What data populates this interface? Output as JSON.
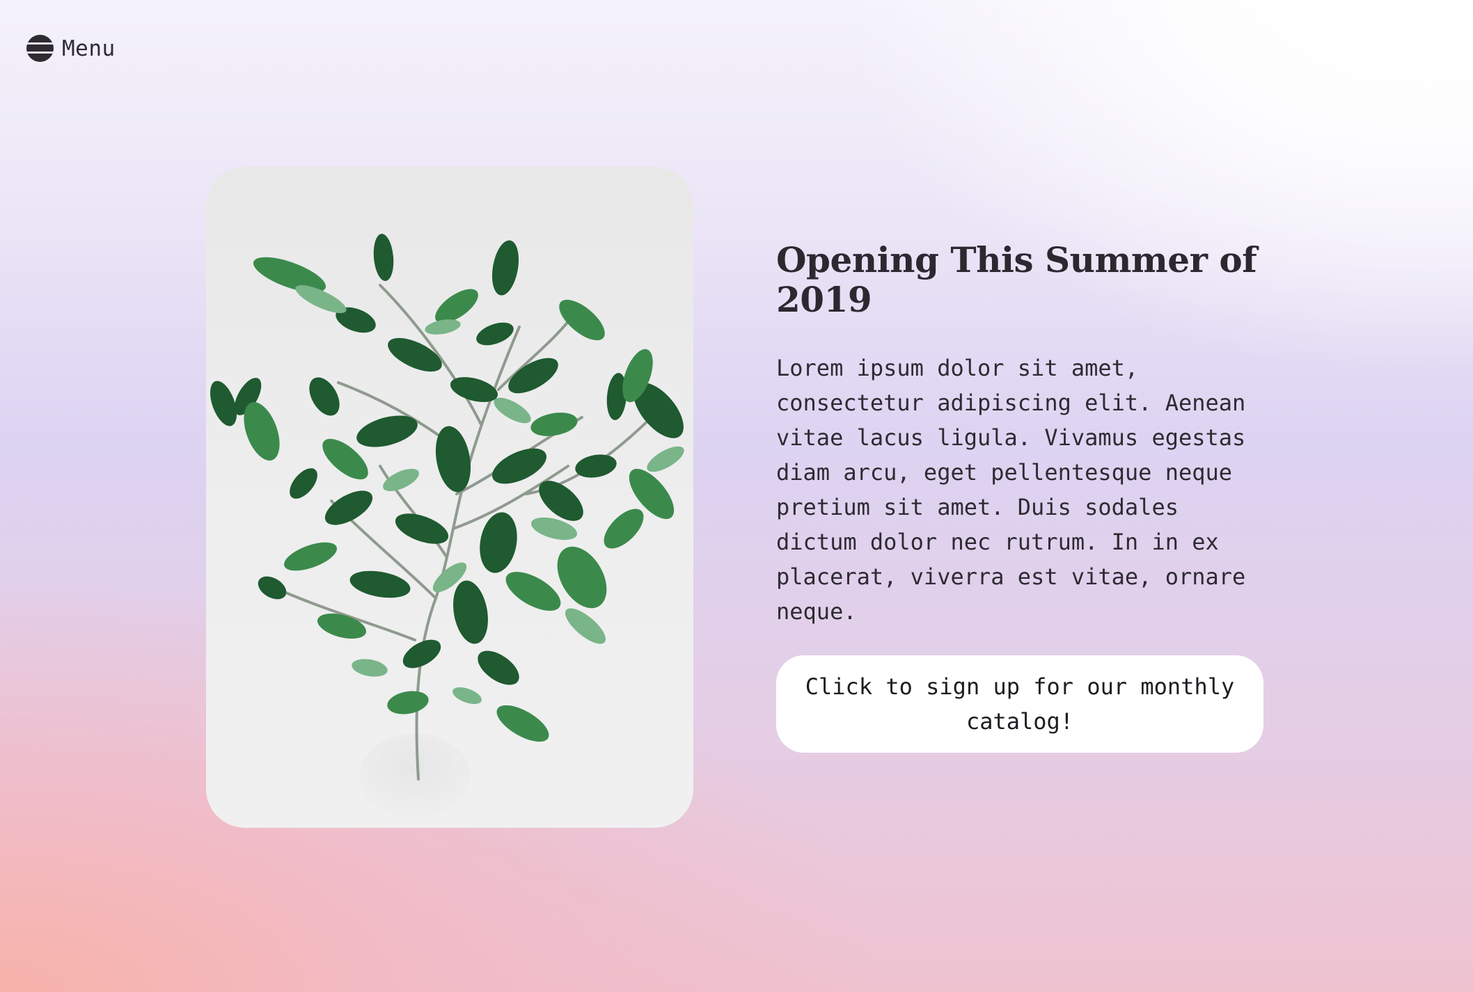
{
  "nav": {
    "menu_label": "Menu",
    "menu_icon": "hamburger-icon"
  },
  "hero": {
    "image_subject": "green leafy branch",
    "heading": "Opening This Summer of 2019",
    "body": "Lorem ipsum dolor sit amet, consectetur adipiscing elit. Aenean vitae lacus ligula. Vivamus egestas diam arcu, eget pellentesque neque pretium sit amet. Duis sodales dictum dolor nec rutrum. In in ex placerat, viverra est vitae, ornare neque.",
    "cta_label": "Click to sign up for our monthly catalog!"
  },
  "colors": {
    "text": "#2e2b32",
    "button_bg": "#ffffff",
    "leaf_dark": "#1f5a30",
    "leaf_mid": "#3b8a4c",
    "leaf_light": "#79b589",
    "background_top": "#f4f2fb",
    "background_lavender": "#ddd3f2",
    "background_bottom_left": "#f7b2aa"
  }
}
